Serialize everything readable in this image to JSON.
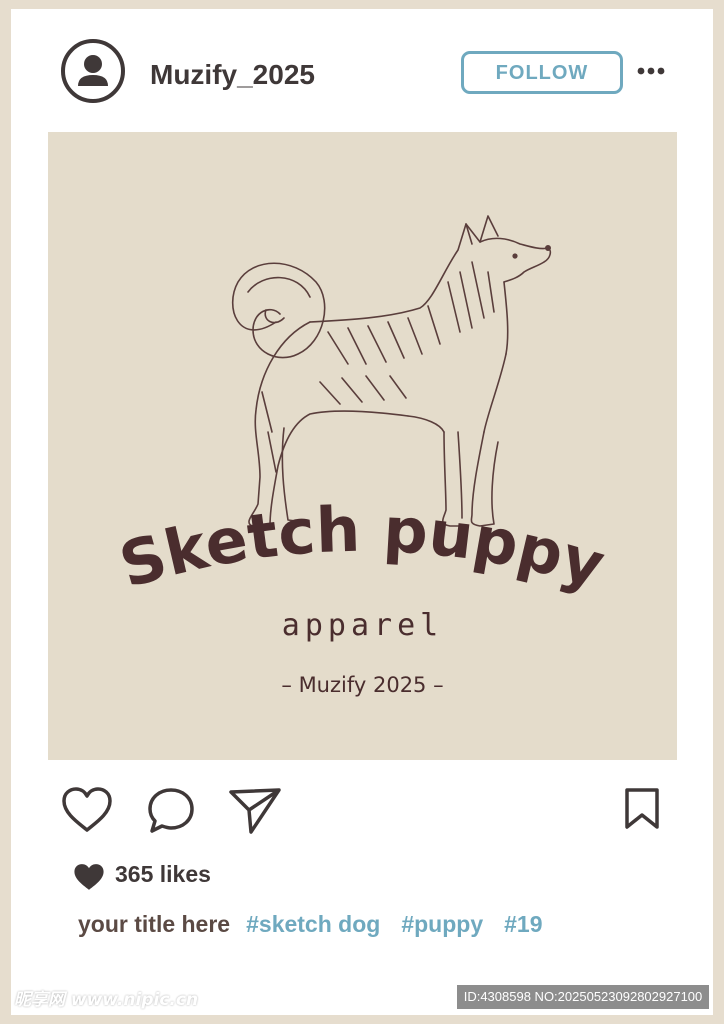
{
  "post": {
    "username": "Muzify_2025",
    "follow_label": "FOLLOW",
    "image": {
      "brand_title": "Sketch puppy",
      "subtitle": "apparel",
      "credit": "– Muzify 2025 –"
    },
    "likes_text": "365 likes",
    "caption_title": "your title here",
    "hashtags": [
      "#sketch dog",
      "#puppy",
      "#19"
    ]
  },
  "watermark": {
    "left": "昵享网 www.nipic.cn",
    "right": "ID:4308598 NO:20250523092802927100"
  },
  "colors": {
    "background": "#e6ddce",
    "card": "#ffffff",
    "image_bg": "#e4dccb",
    "dark_text": "#3f3838",
    "accent": "#6fa9bf",
    "brand_ink": "#4a2d2e"
  },
  "icons": {
    "avatar": "user-icon",
    "more": "more-dots-icon",
    "like": "heart-outline-icon",
    "comment": "comment-bubble-icon",
    "share": "send-paper-plane-icon",
    "save": "bookmark-icon",
    "likes": "heart-filled-icon"
  }
}
